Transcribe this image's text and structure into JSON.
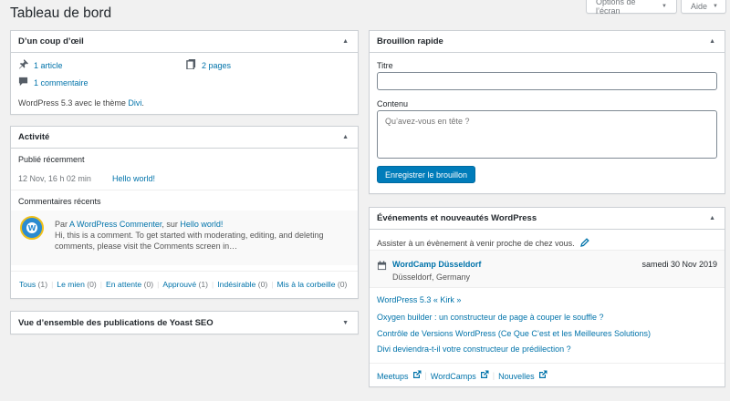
{
  "page": {
    "title": "Tableau de bord"
  },
  "header": {
    "screen_options": "Options de l’écran",
    "help": "Aide"
  },
  "glance": {
    "title": "D’un coup d’œil",
    "posts": "1 article",
    "pages": "2 pages",
    "comments": "1 commentaire",
    "version_prefix": "WordPress 5.3 avec le thème ",
    "theme": "Divi",
    "version_suffix": "."
  },
  "activity": {
    "title": "Activité",
    "published_heading": "Publié récemment",
    "published_date": "12 Nov, 16 h 02 min",
    "published_post": "Hello world!",
    "comments_heading": "Commentaires récents",
    "comment_prefix": "Par ",
    "comment_author": "A WordPress Commenter",
    "comment_on": ", sur ",
    "comment_post": "Hello world!",
    "comment_text": "Hi, this is a comment. To get started with moderating, editing, and deleting comments, please visit the Comments screen in…",
    "filters": [
      {
        "label": "Tous",
        "count": "(1)"
      },
      {
        "label": "Le mien",
        "count": "(0)"
      },
      {
        "label": "En attente",
        "count": "(0)"
      },
      {
        "label": "Approuvé",
        "count": "(1)"
      },
      {
        "label": "Indésirable",
        "count": "(0)"
      },
      {
        "label": "Mis à la corbeille",
        "count": "(0)"
      }
    ]
  },
  "yoast": {
    "title": "Vue d’ensemble des publications de Yoast SEO"
  },
  "quick_draft": {
    "title": "Brouillon rapide",
    "title_label": "Titre",
    "title_value": "",
    "content_label": "Contenu",
    "content_placeholder": "Qu’avez-vous en tête ?",
    "save_button": "Enregistrer le brouillon"
  },
  "events": {
    "title": "Événements et nouveautés WordPress",
    "intro": "Assister à un évènement à venir proche de chez vous.",
    "event_name": "WordCamp Düsseldorf",
    "event_location": "Düsseldorf, Germany",
    "event_date": "samedi 30 Nov 2019",
    "news": [
      "WordPress 5.3 « Kirk »",
      "Oxygen builder : un constructeur de page à couper le souffle ?",
      "Contrôle de Versions WordPress (Ce Que C’est et les Meilleures Solutions)",
      "Divi deviendra-t-il votre constructeur de prédilection ?"
    ],
    "footer": {
      "meetups": "Meetups",
      "wordcamps": "WordCamps",
      "news": "Nouvelles"
    }
  },
  "colors": {
    "link": "#0073aa",
    "primary": "#007cba",
    "background": "#f1f1f1",
    "border": "#ccd0d4"
  }
}
